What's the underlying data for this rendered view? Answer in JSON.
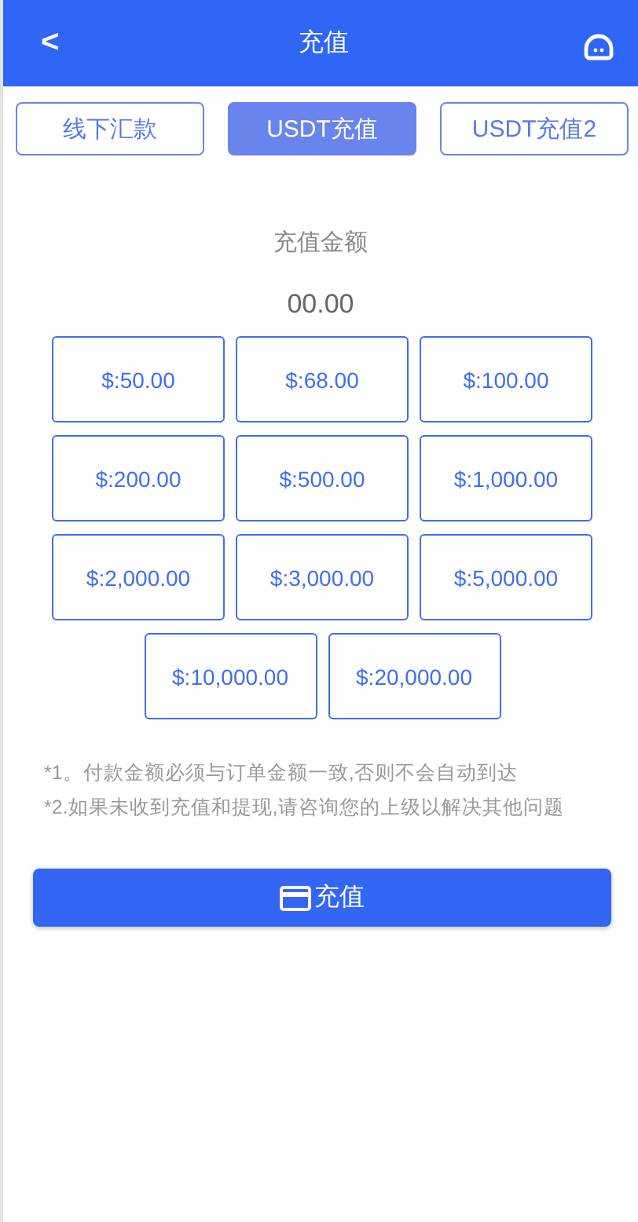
{
  "header": {
    "back": "<",
    "title": "充值"
  },
  "tabs": [
    {
      "label": "线下汇款",
      "selected": false
    },
    {
      "label": "USDT充值",
      "selected": true
    },
    {
      "label": "USDT充值2",
      "selected": false
    }
  ],
  "amount": {
    "label": "充值金额",
    "value": "00.00"
  },
  "presets": [
    "$:50.00",
    "$:68.00",
    "$:100.00",
    "$:200.00",
    "$:500.00",
    "$:1,000.00",
    "$:2,000.00",
    "$:3,000.00",
    "$:5,000.00",
    "$:10,000.00",
    "$:20,000.00"
  ],
  "notes": [
    "*1。付款金额必须与订单金额一致,否则不会自动到达",
    "*2.如果未收到充值和提现,请咨询您的上级以解决其他问题"
  ],
  "submit": {
    "label": "充值"
  }
}
